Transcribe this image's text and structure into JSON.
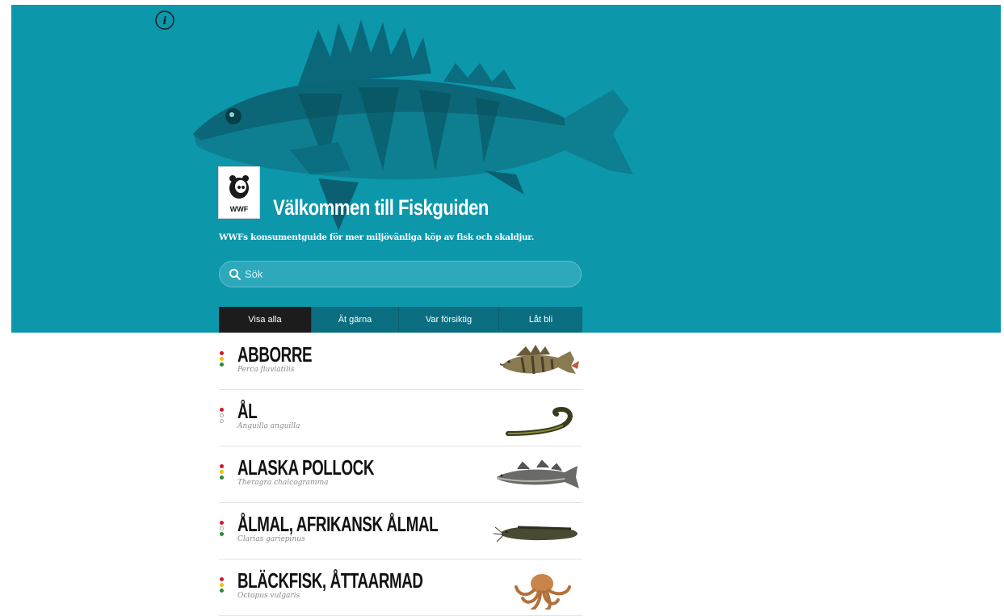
{
  "header": {
    "title": "Välkommen till Fiskguiden",
    "subtitle": "WWFs konsumentguide för mer miljövänliga köp av fisk och skaldjur.",
    "logo_text": "WWF",
    "info_icon": "info-icon"
  },
  "search": {
    "placeholder": "Sök",
    "value": ""
  },
  "tabs": [
    {
      "label": "Visa alla",
      "active": true
    },
    {
      "label": "Ät gärna",
      "active": false
    },
    {
      "label": "Var försiktig",
      "active": false
    },
    {
      "label": "Låt bli",
      "active": false
    }
  ],
  "species": [
    {
      "name": "ABBORRE",
      "latin": "Perca fluviatilis",
      "ratings": [
        "red",
        "yellow",
        "green"
      ]
    },
    {
      "name": "ÅL",
      "latin": "Anguilla anguilla",
      "ratings": [
        "red",
        "empty",
        "empty"
      ]
    },
    {
      "name": "ALASKA POLLOCK",
      "latin": "Theragra chalcogramma",
      "ratings": [
        "red",
        "yellow",
        "green"
      ]
    },
    {
      "name": "ÅLMAL, AFRIKANSK ÅLMAL",
      "latin": "Clarias gariepinus",
      "ratings": [
        "red",
        "empty",
        "green"
      ]
    },
    {
      "name": "BLÄCKFISK, ÅTTAARMAD",
      "latin": "Octopus vulgaris",
      "ratings": [
        "red",
        "yellow",
        "green"
      ]
    }
  ],
  "colors": {
    "hero_bg": "#0c97ab",
    "tab_bg": "#0b6e80",
    "tab_active": "#1c1c1c",
    "rating_red": "#d0182a",
    "rating_yellow": "#f2c200",
    "rating_green": "#2a8a3a"
  }
}
